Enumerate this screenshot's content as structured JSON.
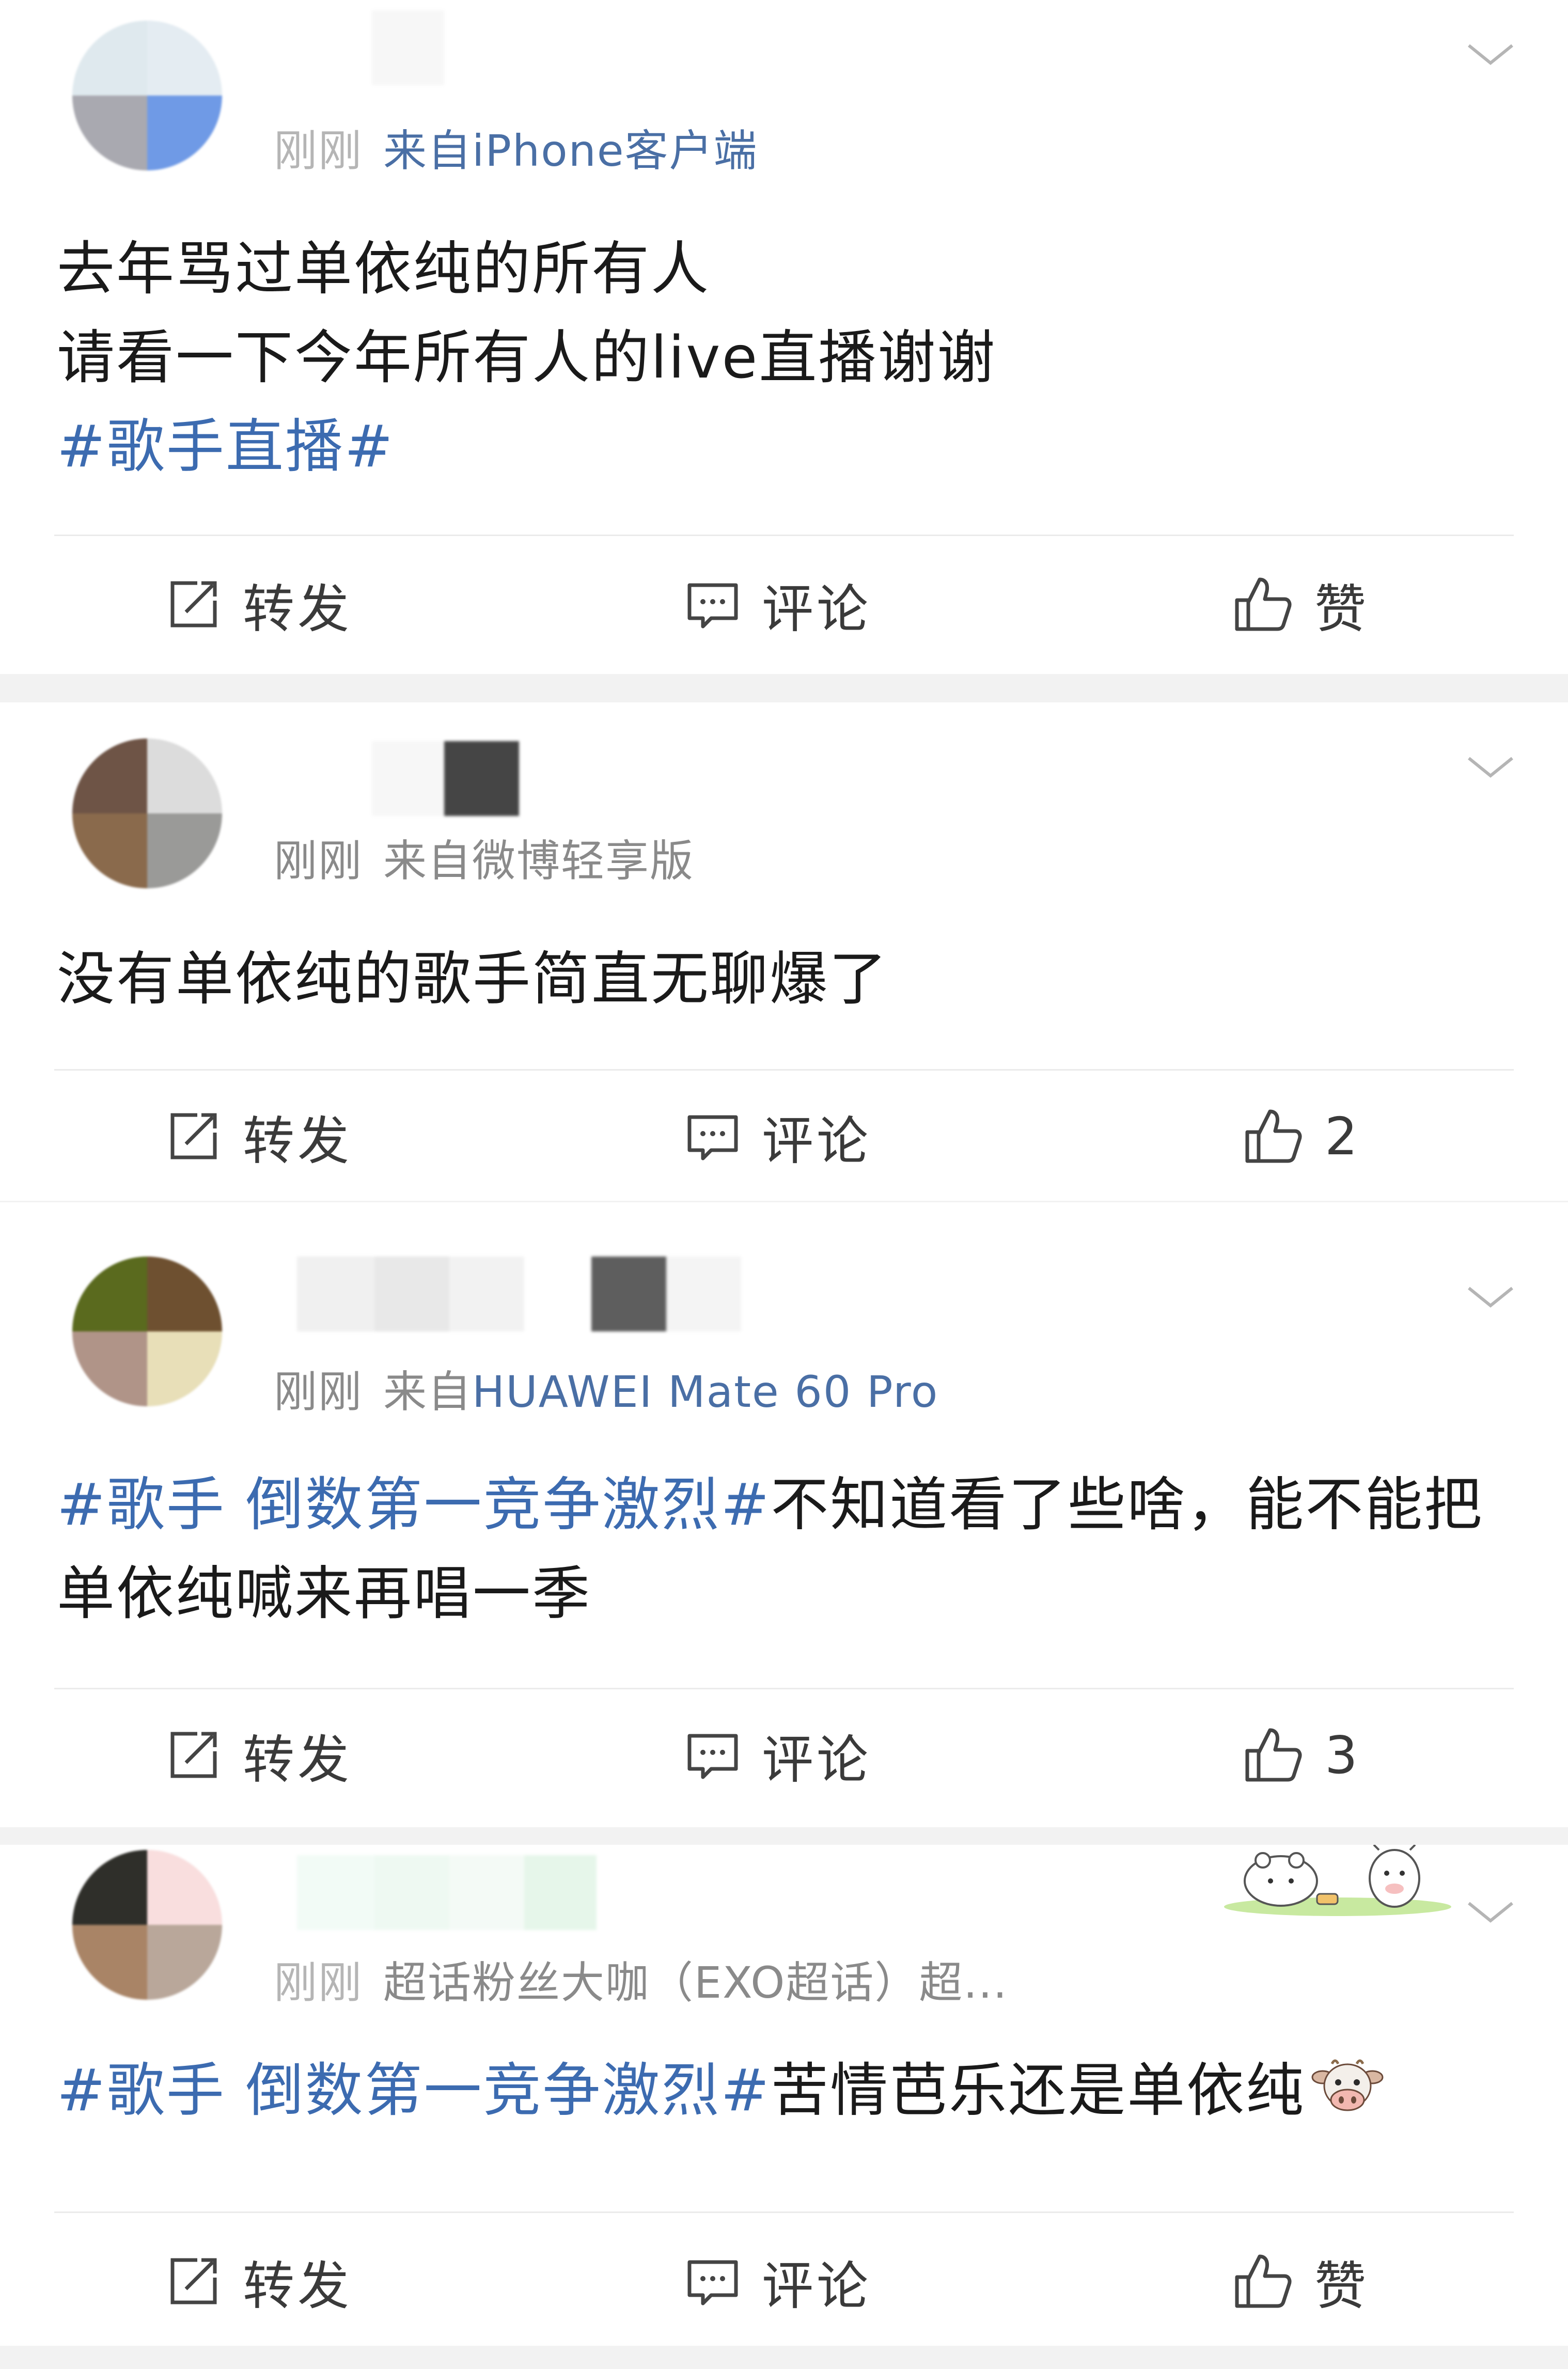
{
  "posts": [
    {
      "time": "刚刚",
      "source": "来自iPhone客户端",
      "content_lines": [
        {
          "text": "去年骂过单依纯的所有人"
        },
        {
          "text": "请看一下今年所有人的live直播谢谢"
        },
        {
          "tag": "#歌手直播#"
        }
      ],
      "actions": {
        "repost": "转发",
        "comment": "评论",
        "like": "赞"
      }
    },
    {
      "time": "刚刚",
      "source": "来自微博轻享版",
      "content_lines": [
        {
          "text": "没有单依纯的歌手简直无聊爆了"
        }
      ],
      "actions": {
        "repost": "转发",
        "comment": "评论",
        "like": "2"
      }
    },
    {
      "time": "刚刚",
      "source_prefix": "来自",
      "source_device": "HUAWEI Mate 60 Pro",
      "content_line1_tag": "#歌手 倒数第一竞争激烈#",
      "content_line1_text": "不知道看了些啥，能不能把",
      "content_line2_text": "单依纯喊来再唱一季",
      "actions": {
        "repost": "转发",
        "comment": "评论",
        "like": "3"
      }
    },
    {
      "time": "刚刚",
      "source": "超话粉丝大咖（EXO超话）超...",
      "content_tag": "#歌手 倒数第一竞争激烈#",
      "content_text": "苦情芭乐还是单依纯",
      "actions": {
        "repost": "转发",
        "comment": "评论",
        "like": "赞"
      }
    }
  ],
  "icons": {
    "more": "chevron-down-icon",
    "repost": "repost-icon",
    "comment": "comment-icon",
    "like": "thumbs-up-icon",
    "emoji": "cow-face-icon",
    "sticker": "cartoon-animals-sticker"
  },
  "colors": {
    "topic_link": "#3c6bb0",
    "meta_gray": "#8a8a8a",
    "divider": "#ebebeb",
    "feed_background": "#f2f2f2"
  }
}
